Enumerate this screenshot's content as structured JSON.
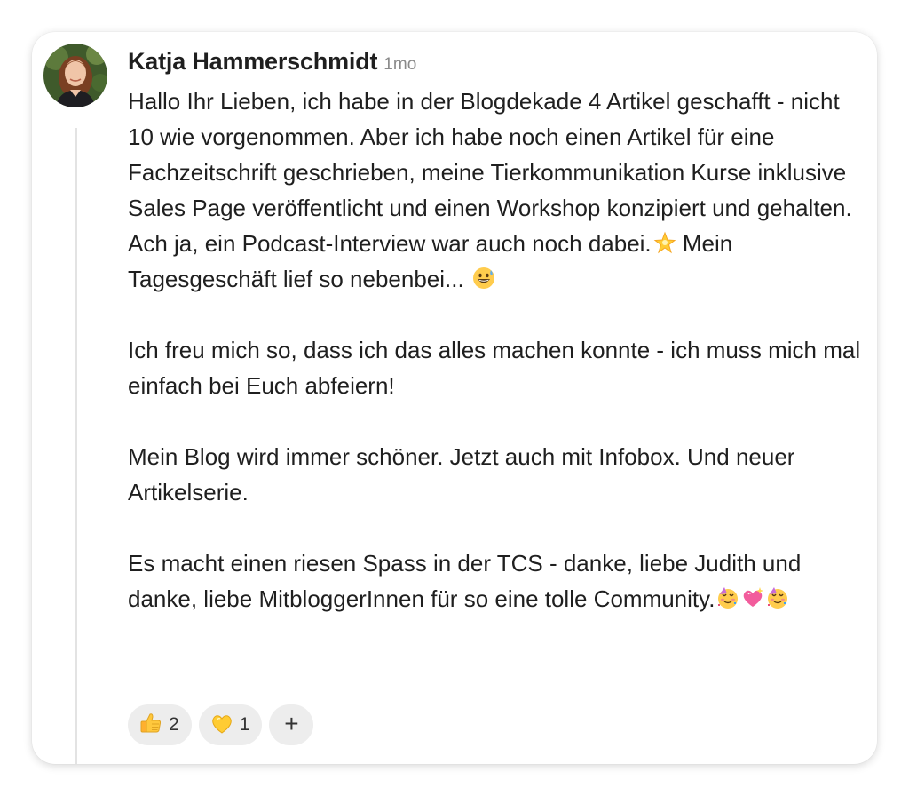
{
  "post": {
    "author": "Katja Hammerschmidt",
    "time": "1mo",
    "paragraphs": [
      {
        "text": "Hallo Ihr Lieben, ich habe in der Blogdekade 4 Artikel geschafft - nicht 10 wie vorgenommen. Aber ich habe noch einen Artikel für eine Fachzeitschrift geschrieben, meine Tierkommunikation Kurse inklusive Sales Page veröffentlicht und einen Workshop konzipiert und gehalten. Ach ja, ein Podcast-Interview war auch noch dabei.",
        "text2": " Mein Tagesgeschäft lief so nebenbei...",
        "emoji1": "glowing-star",
        "emoji2": "grinning-face-with-sweat"
      },
      {
        "text": "Ich freu mich so, dass ich das alles machen konnte - ich muss mich mal einfach bei Euch abfeiern!"
      },
      {
        "text": "Mein Blog wird immer schöner. Jetzt auch mit Infobox. Und neuer Artikelserie."
      },
      {
        "text": "Es macht einen riesen Spass in der TCS - danke, liebe Judith und danke, liebe MitbloggerInnen für so eine tolle Community.",
        "emojis": [
          "partying-face",
          "sparkling-heart",
          "partying-face"
        ]
      }
    ]
  },
  "reactions": [
    {
      "icon": "thumbs-up",
      "count": "2"
    },
    {
      "icon": "yellow-heart",
      "count": "1"
    }
  ],
  "add_reaction_label": "+",
  "colors": {
    "text": "#1f1f1f",
    "muted": "#8a8a8a",
    "pill_bg": "#ededed",
    "thread_line": "#e3e3e3"
  }
}
